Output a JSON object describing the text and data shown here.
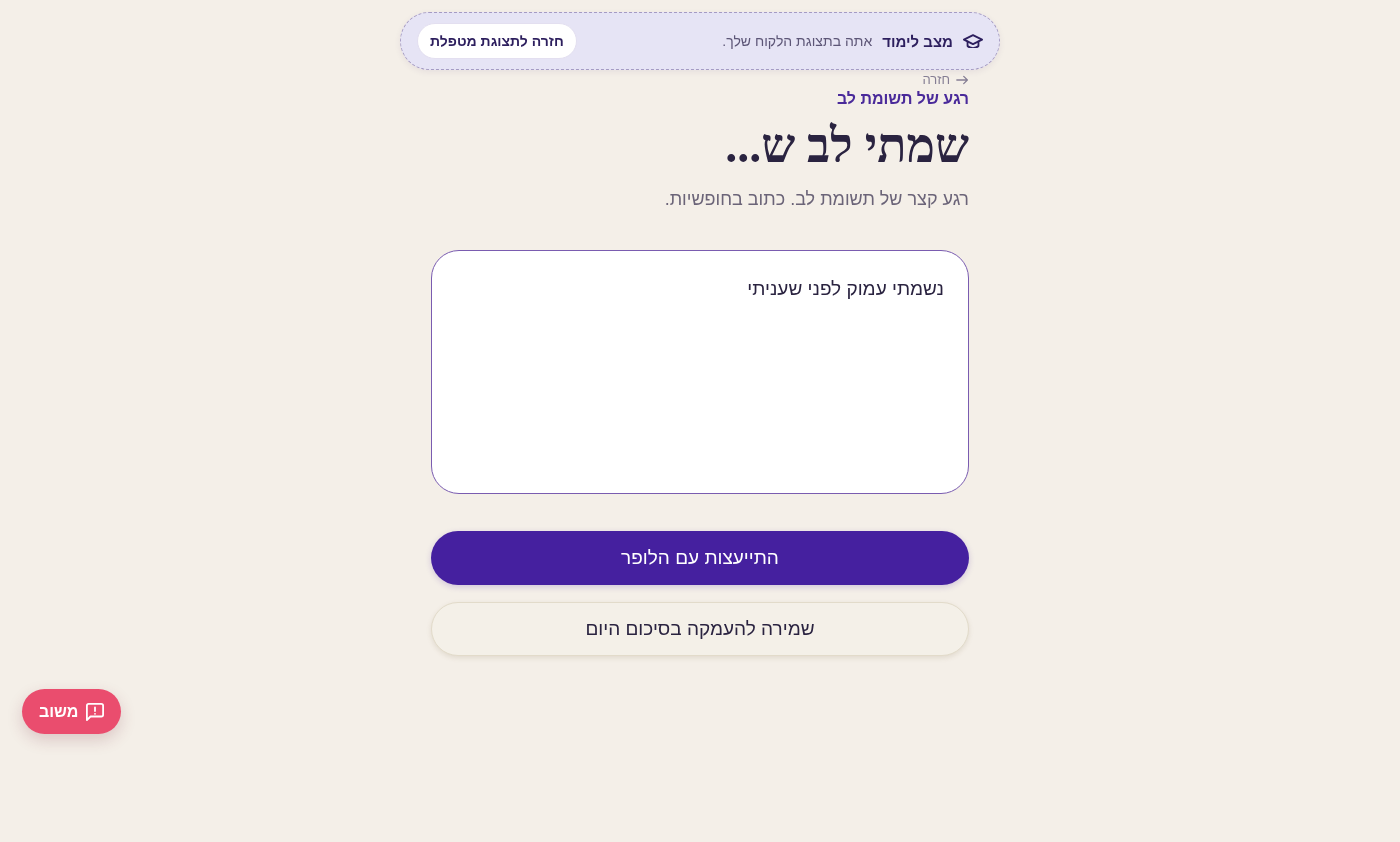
{
  "banner": {
    "title": "מצב לימוד",
    "message": "אתה בתצוגת הלקוח שלך.",
    "button": "חזרה לתצוגת מטפלת"
  },
  "back_link": "חזרה",
  "eyebrow": "רגע של תשומת לב",
  "title": "שמתי לב ש...",
  "subtitle": "רגע קצר של תשומת לב. כתוב בחופשיות.",
  "entry": {
    "value": "נשמתי עמוק לפני שעניתי"
  },
  "actions": [
    {
      "label": "התייעצות עם הלופר",
      "kind": "primary"
    },
    {
      "label": "שמירה להעמקה בסיכום היום",
      "kind": "secondary"
    }
  ],
  "feedback_button": "משוב"
}
